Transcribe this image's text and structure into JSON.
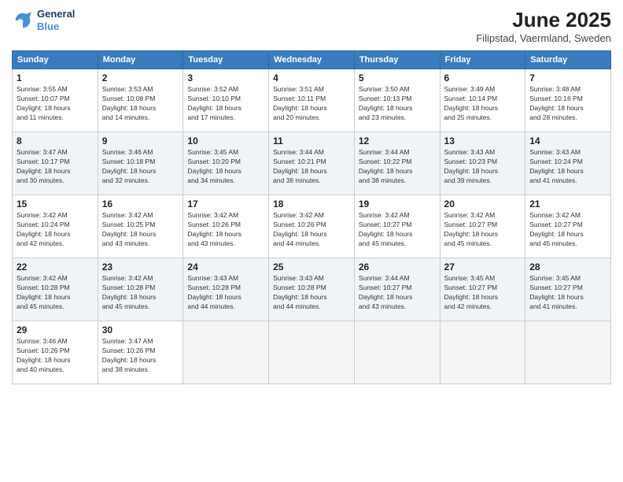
{
  "logo": {
    "line1": "General",
    "line2": "Blue"
  },
  "title": "June 2025",
  "subtitle": "Filipstad, Vaermland, Sweden",
  "days_of_week": [
    "Sunday",
    "Monday",
    "Tuesday",
    "Wednesday",
    "Thursday",
    "Friday",
    "Saturday"
  ],
  "weeks": [
    [
      {
        "day": "1",
        "sunrise": "3:55 AM",
        "sunset": "10:07 PM",
        "daylight": "18 hours and 11 minutes."
      },
      {
        "day": "2",
        "sunrise": "3:53 AM",
        "sunset": "10:08 PM",
        "daylight": "18 hours and 14 minutes."
      },
      {
        "day": "3",
        "sunrise": "3:52 AM",
        "sunset": "10:10 PM",
        "daylight": "18 hours and 17 minutes."
      },
      {
        "day": "4",
        "sunrise": "3:51 AM",
        "sunset": "10:11 PM",
        "daylight": "18 hours and 20 minutes."
      },
      {
        "day": "5",
        "sunrise": "3:50 AM",
        "sunset": "10:13 PM",
        "daylight": "18 hours and 23 minutes."
      },
      {
        "day": "6",
        "sunrise": "3:49 AM",
        "sunset": "10:14 PM",
        "daylight": "18 hours and 25 minutes."
      },
      {
        "day": "7",
        "sunrise": "3:48 AM",
        "sunset": "10:16 PM",
        "daylight": "18 hours and 28 minutes."
      }
    ],
    [
      {
        "day": "8",
        "sunrise": "3:47 AM",
        "sunset": "10:17 PM",
        "daylight": "18 hours and 30 minutes."
      },
      {
        "day": "9",
        "sunrise": "3:46 AM",
        "sunset": "10:18 PM",
        "daylight": "18 hours and 32 minutes."
      },
      {
        "day": "10",
        "sunrise": "3:45 AM",
        "sunset": "10:20 PM",
        "daylight": "18 hours and 34 minutes."
      },
      {
        "day": "11",
        "sunrise": "3:44 AM",
        "sunset": "10:21 PM",
        "daylight": "18 hours and 36 minutes."
      },
      {
        "day": "12",
        "sunrise": "3:44 AM",
        "sunset": "10:22 PM",
        "daylight": "18 hours and 38 minutes."
      },
      {
        "day": "13",
        "sunrise": "3:43 AM",
        "sunset": "10:23 PM",
        "daylight": "18 hours and 39 minutes."
      },
      {
        "day": "14",
        "sunrise": "3:43 AM",
        "sunset": "10:24 PM",
        "daylight": "18 hours and 41 minutes."
      }
    ],
    [
      {
        "day": "15",
        "sunrise": "3:42 AM",
        "sunset": "10:24 PM",
        "daylight": "18 hours and 42 minutes."
      },
      {
        "day": "16",
        "sunrise": "3:42 AM",
        "sunset": "10:25 PM",
        "daylight": "18 hours and 43 minutes."
      },
      {
        "day": "17",
        "sunrise": "3:42 AM",
        "sunset": "10:26 PM",
        "daylight": "18 hours and 43 minutes."
      },
      {
        "day": "18",
        "sunrise": "3:42 AM",
        "sunset": "10:26 PM",
        "daylight": "18 hours and 44 minutes."
      },
      {
        "day": "19",
        "sunrise": "3:42 AM",
        "sunset": "10:27 PM",
        "daylight": "18 hours and 45 minutes."
      },
      {
        "day": "20",
        "sunrise": "3:42 AM",
        "sunset": "10:27 PM",
        "daylight": "18 hours and 45 minutes."
      },
      {
        "day": "21",
        "sunrise": "3:42 AM",
        "sunset": "10:27 PM",
        "daylight": "18 hours and 45 minutes."
      }
    ],
    [
      {
        "day": "22",
        "sunrise": "3:42 AM",
        "sunset": "10:28 PM",
        "daylight": "18 hours and 45 minutes."
      },
      {
        "day": "23",
        "sunrise": "3:42 AM",
        "sunset": "10:28 PM",
        "daylight": "18 hours and 45 minutes."
      },
      {
        "day": "24",
        "sunrise": "3:43 AM",
        "sunset": "10:28 PM",
        "daylight": "18 hours and 44 minutes."
      },
      {
        "day": "25",
        "sunrise": "3:43 AM",
        "sunset": "10:28 PM",
        "daylight": "18 hours and 44 minutes."
      },
      {
        "day": "26",
        "sunrise": "3:44 AM",
        "sunset": "10:27 PM",
        "daylight": "18 hours and 43 minutes."
      },
      {
        "day": "27",
        "sunrise": "3:45 AM",
        "sunset": "10:27 PM",
        "daylight": "18 hours and 42 minutes."
      },
      {
        "day": "28",
        "sunrise": "3:45 AM",
        "sunset": "10:27 PM",
        "daylight": "18 hours and 41 minutes."
      }
    ],
    [
      {
        "day": "29",
        "sunrise": "3:46 AM",
        "sunset": "10:26 PM",
        "daylight": "18 hours and 40 minutes."
      },
      {
        "day": "30",
        "sunrise": "3:47 AM",
        "sunset": "10:26 PM",
        "daylight": "18 hours and 38 minutes."
      },
      null,
      null,
      null,
      null,
      null
    ]
  ],
  "labels": {
    "sunrise": "Sunrise:",
    "sunset": "Sunset:",
    "daylight": "Daylight:"
  }
}
